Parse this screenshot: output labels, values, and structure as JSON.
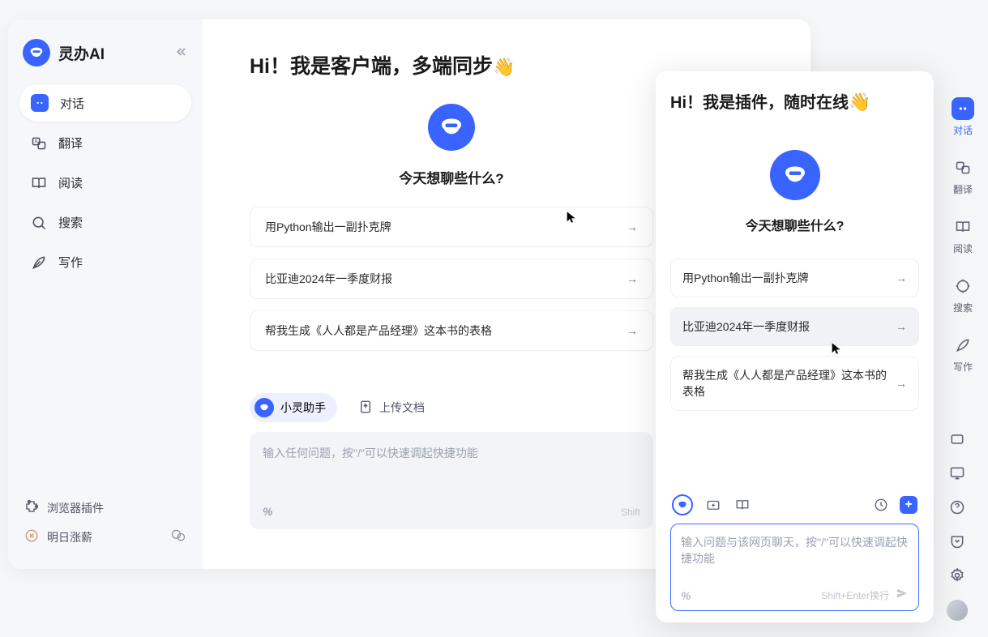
{
  "brand": {
    "title": "灵办AI"
  },
  "sidebar": {
    "items": [
      {
        "label": "对话"
      },
      {
        "label": "翻译"
      },
      {
        "label": "阅读"
      },
      {
        "label": "搜索"
      },
      {
        "label": "写作"
      }
    ],
    "browser_plugin": "浏览器插件",
    "promo": "明日涨薪"
  },
  "client": {
    "title_prefix": "Hi！我是客户端，多端同步",
    "hero_question": "今天想聊些什么?",
    "suggestions": [
      "用Python输出一副扑克牌",
      "比亚迪2024年一季度财报",
      "帮我生成《人人都是产品经理》这本书的表格"
    ],
    "assistant_label": "小灵助手",
    "upload_label": "上传文档",
    "input_placeholder": "输入任何问题，按\"/\"可以快速调起快捷功能",
    "shift_hint": "Shift"
  },
  "plugin": {
    "title_prefix": "Hi！我是插件，随时在线",
    "hero_question": "今天想聊些什么?",
    "suggestions": [
      "用Python输出一副扑克牌",
      "比亚迪2024年一季度财报",
      "帮我生成《人人都是产品经理》这本书的表格"
    ],
    "input_placeholder": "输入问题与该网页聊天，按\"/\"可以快速调起快捷功能",
    "shift_hint": "Shift+Enter换行"
  },
  "rail": {
    "items": [
      {
        "label": "对话"
      },
      {
        "label": "翻译"
      },
      {
        "label": "阅读"
      },
      {
        "label": "搜索"
      },
      {
        "label": "写作"
      }
    ]
  }
}
